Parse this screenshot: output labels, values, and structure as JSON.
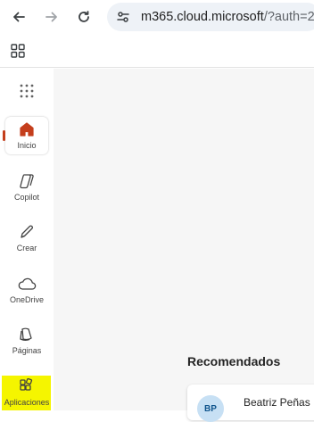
{
  "browser": {
    "url_host": "m365.cloud.microsoft",
    "url_rest": "/?auth=2"
  },
  "rail": {
    "items": [
      {
        "label": "Inicio",
        "icon": "home-icon"
      },
      {
        "label": "Copilot",
        "icon": "copilot-icon"
      },
      {
        "label": "Crear",
        "icon": "pen-icon"
      },
      {
        "label": "OneDrive",
        "icon": "cloud-icon"
      },
      {
        "label": "Páginas",
        "icon": "pages-icon"
      },
      {
        "label": "Aplicaciones",
        "icon": "apps-icon"
      }
    ],
    "active_color": "#c43e1c"
  },
  "main": {
    "recommended_title": "Recomendados",
    "card": {
      "initials": "BP",
      "name": "Beatriz Peñas"
    }
  }
}
